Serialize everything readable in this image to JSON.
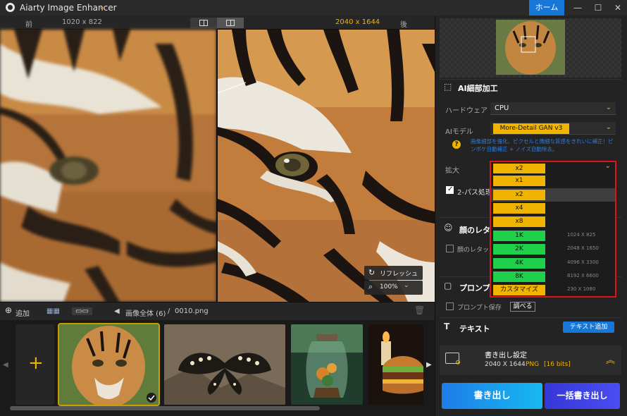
{
  "window": {
    "app_title": "Aiarty Image Enhancer",
    "home_label": "ホーム",
    "minimize": "—",
    "maximize": "☐",
    "close": "✕"
  },
  "preview": {
    "before_label": "前",
    "before_size": "1020 x 822",
    "after_size": "2040 x 1644",
    "after_label": "後",
    "refresh_label": "リフレッシュ",
    "zoom_label": "100%"
  },
  "file_toolbar": {
    "add_label": "追加",
    "breadcrumb_all": "画像全体 (6)",
    "breadcrumb_sep": "/",
    "current_file": "0010.png"
  },
  "right_panel": {
    "ai_section_title": "AI細部加工",
    "hardware_label": "ハードウェア",
    "hardware_value": "CPU",
    "model_label": "AIモデル",
    "model_value": "More-Detail GAN  v3",
    "model_hint": "画像細部を強化。ピクセルと微細な質感をきれいに補正！ピンボケ自動補正 + ノイズ自動除去。",
    "scale_label": "拡大",
    "scale_current": "x2",
    "twopass_label": "2-パス処理",
    "face_section": "顔のレタ",
    "face_option": "顔のレタッ",
    "prompt_section": "プロンプ",
    "prompt_save_label": "プロンプト保存",
    "search_label": "調べる",
    "text_section": "テキスト",
    "text_add_label": "テキスト追加",
    "export_settings_title": "書き出し設定",
    "export_size": "2040 X 1644",
    "export_format": "PNG",
    "export_bits": "[16 bits]",
    "export_label": "書き出し",
    "batch_export_label": "一括書き出し"
  },
  "scale_options": [
    {
      "label": "x1",
      "dims": "",
      "color": "yellow"
    },
    {
      "label": "x2",
      "dims": "",
      "color": "yellow"
    },
    {
      "label": "x4",
      "dims": "",
      "color": "yellow"
    },
    {
      "label": "x8",
      "dims": "",
      "color": "yellow"
    },
    {
      "label": "1K",
      "dims": "1024 X 825",
      "color": "green"
    },
    {
      "label": "2K",
      "dims": "2048 X 1650",
      "color": "green"
    },
    {
      "label": "4K",
      "dims": "4096 X 3300",
      "color": "green"
    },
    {
      "label": "8K",
      "dims": "8192 X 6600",
      "color": "green"
    },
    {
      "label": "カスタマイズ",
      "dims": "230 X 1080",
      "color": "yellow"
    }
  ],
  "thumbnails": [
    "tiger",
    "butterfly",
    "jar-terrarium",
    "burger"
  ]
}
